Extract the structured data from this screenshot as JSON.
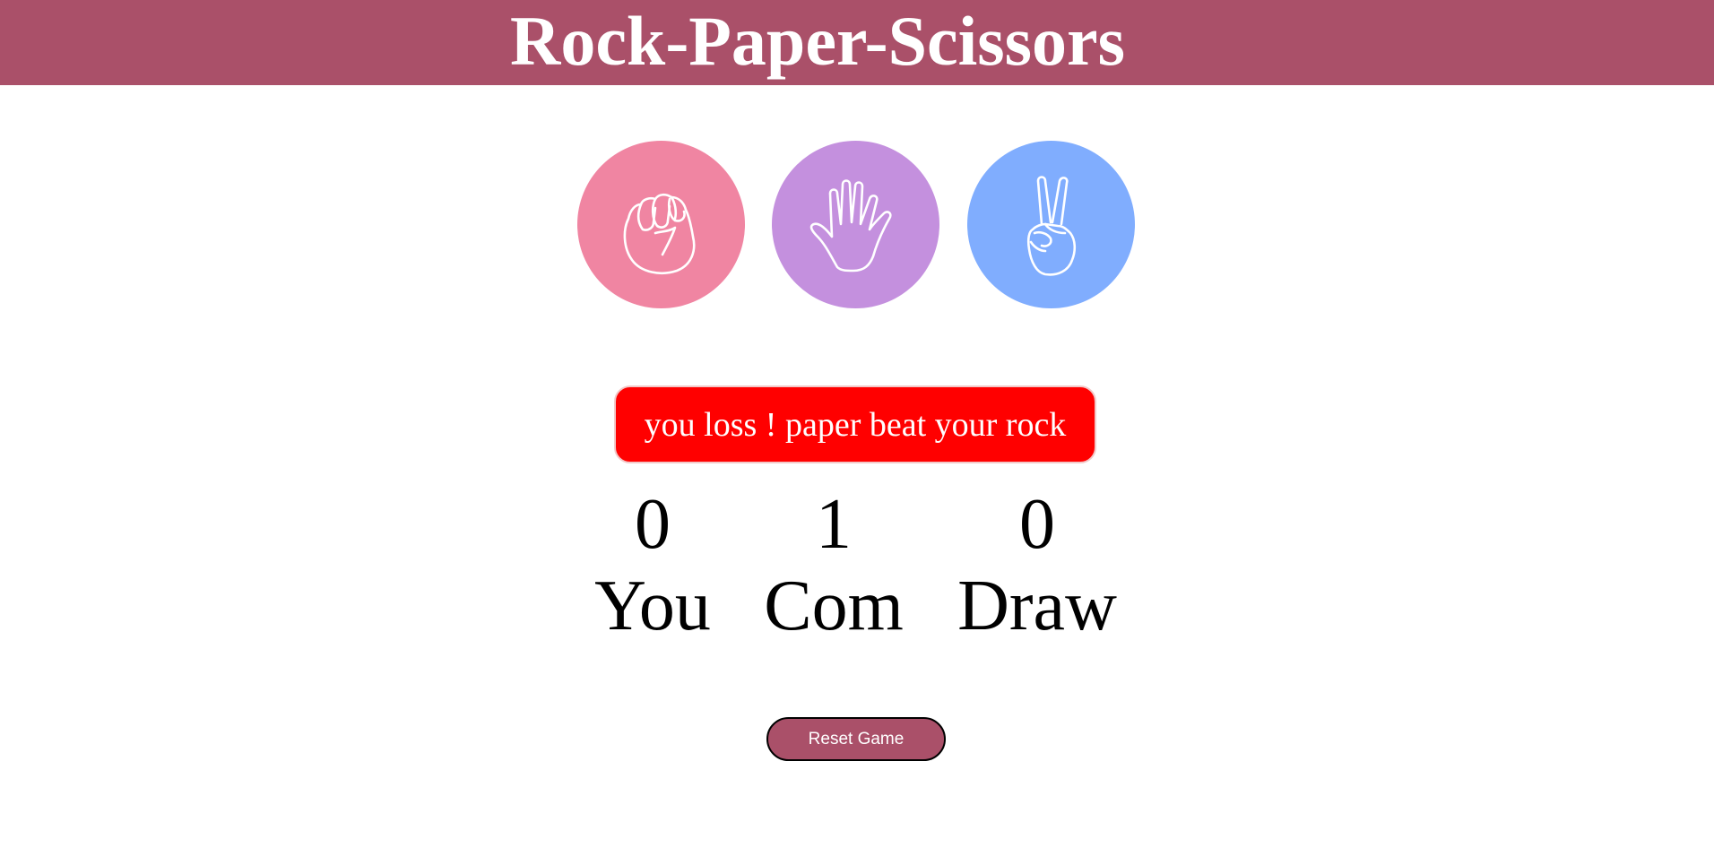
{
  "header": {
    "title": "Rock-Paper-Scissors"
  },
  "choices": [
    {
      "id": "rock",
      "icon": "rock-hand-icon",
      "color": "#f085a2"
    },
    {
      "id": "paper",
      "icon": "paper-hand-icon",
      "color": "#c490de"
    },
    {
      "id": "scissors",
      "icon": "scissors-hand-icon",
      "color": "#80adfe"
    }
  ],
  "message": {
    "text": "you loss ! paper beat your rock",
    "color": "#ff0000"
  },
  "scores": {
    "you": {
      "value": "0",
      "label": "You"
    },
    "com": {
      "value": "1",
      "label": "Com"
    },
    "draw": {
      "value": "0",
      "label": "Draw"
    }
  },
  "reset": {
    "label": "Reset Game",
    "color": "#aa5069"
  },
  "colors": {
    "header_bg": "#aa5069"
  }
}
